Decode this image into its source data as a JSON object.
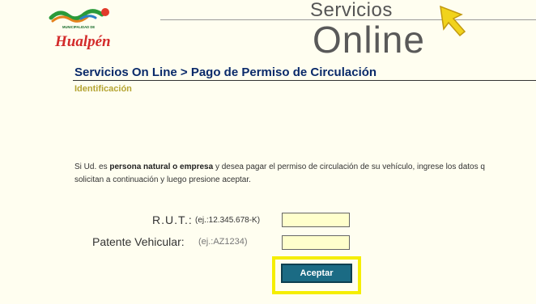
{
  "logo": {
    "small_text": "MUNICIPALIDAD DE",
    "name": "Hualpén"
  },
  "header": {
    "servicios": "Servicios",
    "online": "Online"
  },
  "breadcrumb": {
    "path": "Servicios On Line",
    "separator": ">",
    "current": "Pago de Permiso de Circulación"
  },
  "section_title": "Identificación",
  "instructions": {
    "part1": "Si Ud. es ",
    "bold": "persona natural o empresa",
    "part2": " y desea pagar el permiso de circulación de su vehículo, ingrese los datos q",
    "line2": "solicitan a continuación y luego presione aceptar."
  },
  "form": {
    "rut_label": "R.U.T.:",
    "rut_hint": "(ej.:12.345.678-K)",
    "rut_value": "",
    "patente_label": "Patente Vehicular:",
    "patente_hint": "(ej.:AZ1234)",
    "patente_value": "",
    "accept_label": "Aceptar"
  },
  "colors": {
    "background": "#fffef0",
    "breadcrumb": "#0a2a6a",
    "section_title": "#b5a432",
    "button": "#1b6b84",
    "highlight": "#f5ee00",
    "input_bg": "#ffffcc"
  }
}
